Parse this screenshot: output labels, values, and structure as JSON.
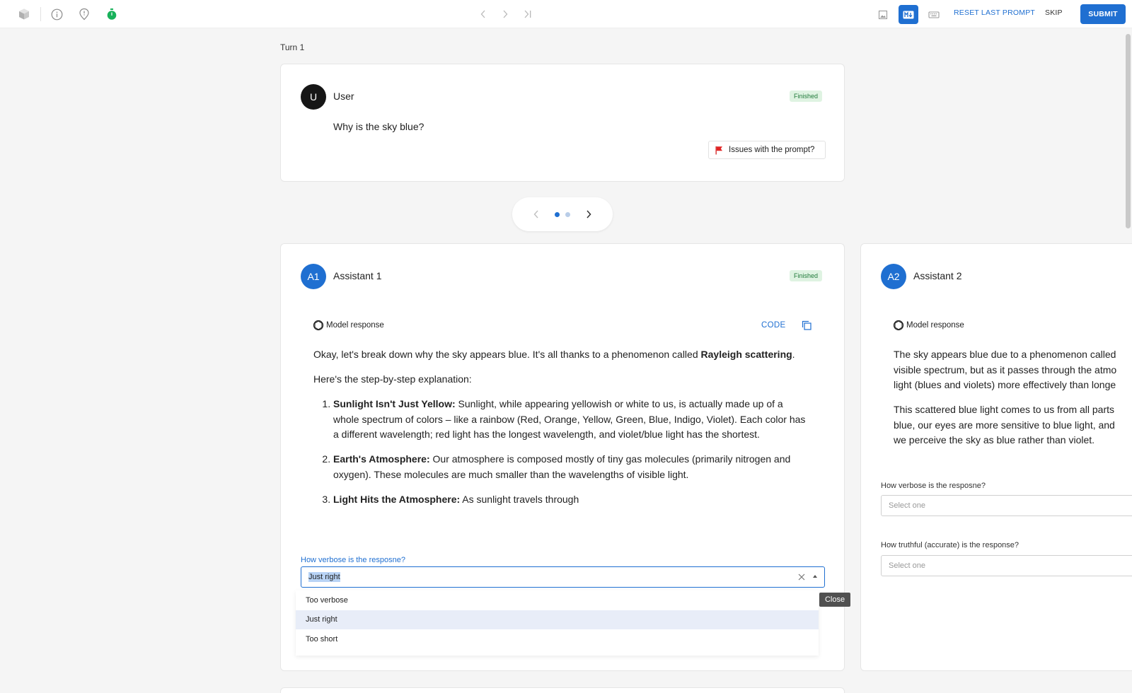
{
  "topbar": {
    "icons": [
      "cube-icon",
      "info-icon",
      "location-pin-icon",
      "timer-icon"
    ],
    "nav": [
      "chevron-left-icon",
      "chevron-right-icon",
      "skip-to-end-icon"
    ],
    "modes": [
      "image-icon",
      "markdown-icon",
      "keyboard-icon"
    ],
    "active_mode": "markdown-icon",
    "reset_label": "RESET LAST PROMPT",
    "skip_label": "SKIP",
    "submit_label": "SUBMIT",
    "accent_color": "#1f6fd1"
  },
  "turn_label": "Turn 1",
  "user": {
    "avatar": "U",
    "name": "User",
    "status": "Finished",
    "prompt": "Why is the sky blue?",
    "issues_label": "Issues with the prompt?"
  },
  "pager": {
    "pages": 2,
    "current": 1
  },
  "assistant1": {
    "avatar": "A1",
    "name": "Assistant 1",
    "status": "Finished",
    "model_response_label": "Model response",
    "code_label": "CODE",
    "intro_prefix": "Okay, let's break down why the sky appears blue. It's all thanks to a phenomenon called ",
    "intro_bold": "Rayleigh scattering",
    "intro_suffix": ".",
    "step_intro": "Here's the step-by-step explanation:",
    "steps": [
      {
        "title": "Sunlight Isn't Just Yellow:",
        "text": " Sunlight, while appearing yellowish or white to us, is actually made up of a whole spectrum of colors – like a rainbow (Red, Orange, Yellow, Green, Blue, Indigo, Violet). Each color has a different wavelength; red light has the longest wavelength, and violet/blue light has the shortest."
      },
      {
        "title": "Earth's Atmosphere:",
        "text": " Our atmosphere is composed mostly of tiny gas molecules (primarily nitrogen and oxygen). These molecules are much smaller than the wavelengths of visible light."
      },
      {
        "title": "Light Hits the Atmosphere:",
        "text": " As sunlight travels through"
      }
    ],
    "verbose_question": "How verbose is the resposne?",
    "verbose_value": "Just right",
    "dropdown_options": [
      "Too verbose",
      "Just right",
      "Too short"
    ],
    "dropdown_selected": "Just right",
    "tooltip": "Close"
  },
  "assistant2": {
    "avatar": "A2",
    "name": "Assistant 2",
    "model_response_label": "Model response",
    "para1_lines": [
      "The sky appears blue due to a phenomenon called",
      "visible spectrum, but as it passes through the atmo",
      "light (blues and violets) more effectively than longe"
    ],
    "para2_lines": [
      "This scattered blue light comes to us from all parts",
      "blue, our eyes are more sensitive to blue light, and",
      "we perceive the sky as blue rather than violet."
    ],
    "verbose_question": "How verbose is the resposne?",
    "verbose_placeholder": "Select one",
    "truthful_question": "How truthful (accurate) is the response?",
    "truthful_placeholder": "Select one"
  }
}
